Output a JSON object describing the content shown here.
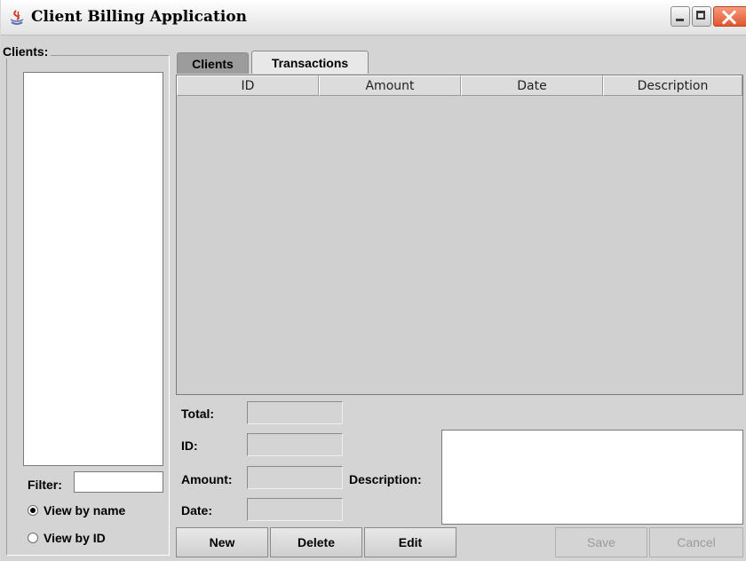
{
  "window": {
    "title": "Client Billing Application"
  },
  "clients_panel": {
    "legend": "Clients:",
    "filter_label": "Filter:",
    "filter_value": "",
    "view_by_name": "View by name",
    "view_by_id": "View by ID",
    "selected_view": "View by name"
  },
  "tabs": [
    {
      "label": "Clients",
      "active": false
    },
    {
      "label": "Transactions",
      "active": true
    }
  ],
  "table": {
    "columns": [
      "ID",
      "Amount",
      "Date",
      "Description"
    ],
    "rows": []
  },
  "form": {
    "total_label": "Total:",
    "id_label": "ID:",
    "amount_label": "Amount:",
    "date_label": "Date:",
    "description_label": "Description:",
    "total_value": "",
    "id_value": "",
    "amount_value": "",
    "date_value": "",
    "description_value": ""
  },
  "buttons": {
    "new": "New",
    "delete": "Delete",
    "edit": "Edit",
    "save": "Save",
    "cancel": "Cancel"
  },
  "colors": {
    "window_bg": "#d4d4d4",
    "close_button": "#e2562d"
  }
}
